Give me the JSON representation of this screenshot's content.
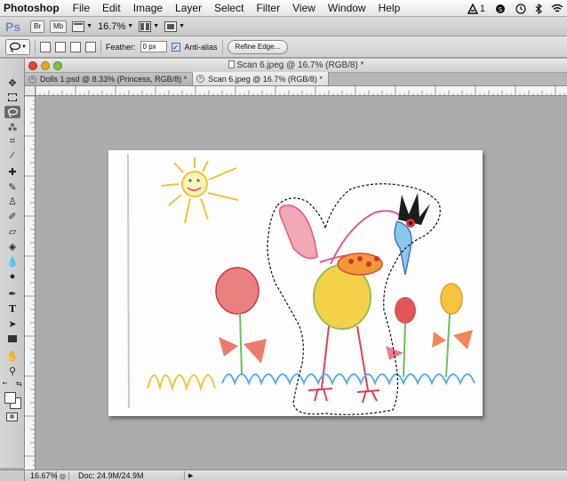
{
  "menubar": {
    "app_name": "Photoshop",
    "items": [
      "File",
      "Edit",
      "Image",
      "Layer",
      "Select",
      "Filter",
      "View",
      "Window",
      "Help"
    ],
    "status": {
      "adobe_badge": "1"
    }
  },
  "appbar": {
    "logo": "Ps",
    "bridge_label": "Br",
    "minibridge_label": "Mb",
    "zoom_value": "16.7%"
  },
  "options": {
    "feather_label": "Feather:",
    "feather_value": "0 px",
    "antialias_label": "Anti-alias",
    "antialias_checked": true,
    "refine_edge_label": "Refine Edge..."
  },
  "window": {
    "title": "Scan 6.jpeg @ 16.7% (RGB/8) *"
  },
  "tabs": [
    {
      "label": "Dolls 1.psd @ 8.33% (Princess, RGB/8) *",
      "active": false
    },
    {
      "label": "Scan 6.jpeg @ 16.7% (RGB/8) *",
      "active": true
    }
  ],
  "tools": [
    "move-icon",
    "marquee-icon",
    "lasso-icon",
    "quick-selection-icon",
    "crop-icon",
    "eyedropper-icon",
    "healing-brush-icon",
    "brush-icon",
    "clone-stamp-icon",
    "history-brush-icon",
    "eraser-icon",
    "paint-bucket-icon",
    "blur-icon",
    "dodge-icon",
    "pen-icon",
    "type-icon",
    "path-selection-icon",
    "rectangle-icon",
    "hand-icon",
    "zoom-icon"
  ],
  "colors": {
    "foreground": "#ffffff",
    "background": "#ffffff",
    "selected_tool": "#6b6b6b",
    "canvas_background": "#ababab"
  },
  "statusbar": {
    "zoom": "16.67%",
    "doc_size": "Doc: 24.9M/24.9M"
  }
}
